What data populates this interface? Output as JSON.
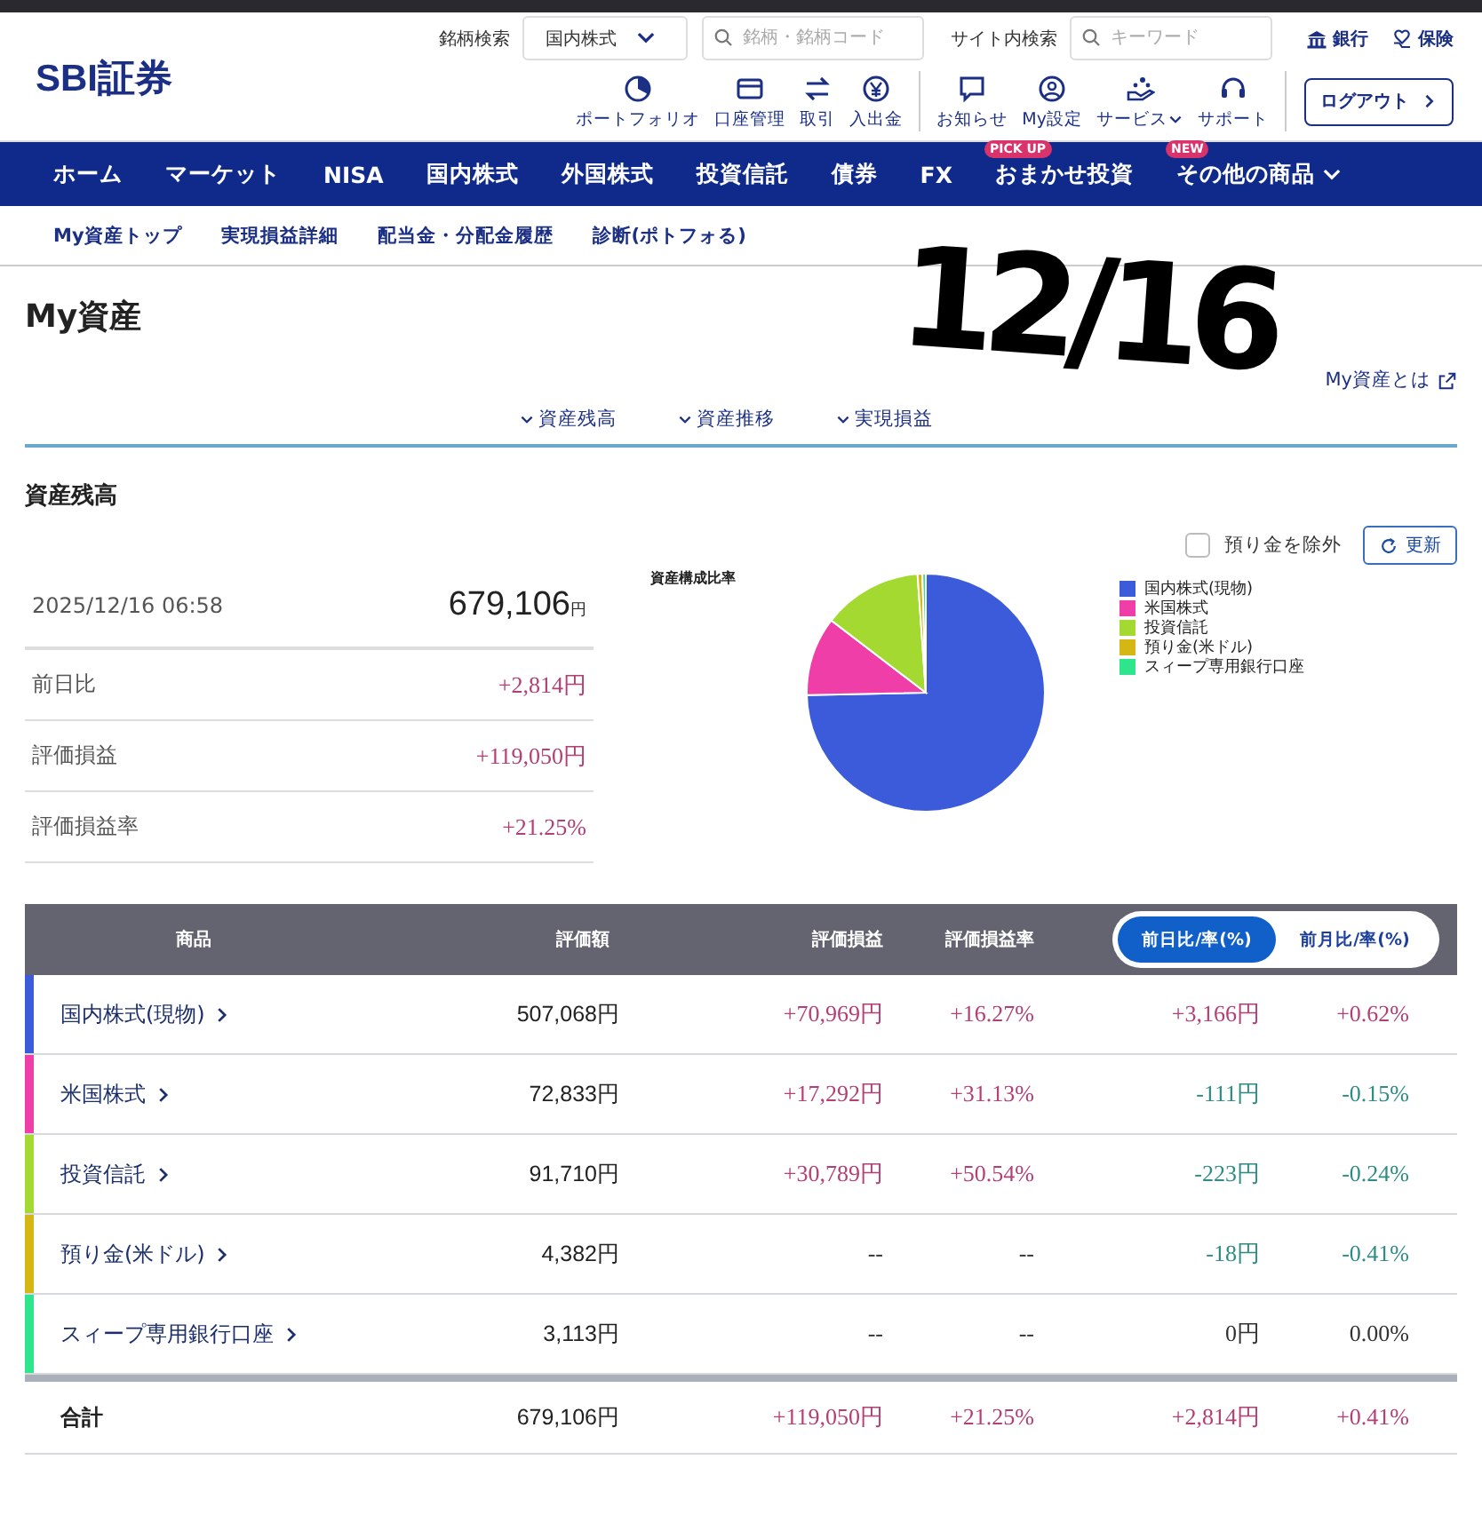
{
  "header": {
    "logo": "SBI証券",
    "stock_search": {
      "label": "銘柄検索",
      "market": "国内株式",
      "placeholder": "銘柄・銘柄コード"
    },
    "site_search": {
      "label": "サイト内検索",
      "placeholder": "キーワード"
    },
    "links": [
      {
        "label": "銀行",
        "kind": "bank"
      },
      {
        "label": "保険",
        "kind": "insurance"
      }
    ],
    "tool_groups": [
      [
        {
          "label": "ポートフォリオ",
          "kind": "portfolio",
          "dropdown": false
        },
        {
          "label": "口座管理",
          "kind": "account",
          "dropdown": false
        },
        {
          "label": "取引",
          "kind": "trade",
          "dropdown": false
        },
        {
          "label": "入出金",
          "kind": "deposit",
          "dropdown": false
        }
      ],
      [
        {
          "label": "お知らせ",
          "kind": "notice",
          "dropdown": false
        },
        {
          "label": "My設定",
          "kind": "user",
          "dropdown": false
        },
        {
          "label": "サービス",
          "kind": "service",
          "dropdown": true
        },
        {
          "label": "サポート",
          "kind": "support",
          "dropdown": false
        }
      ]
    ],
    "logout": "ログアウト"
  },
  "nav": [
    {
      "label": "ホーム",
      "dropdown": false
    },
    {
      "label": "マーケット",
      "dropdown": false
    },
    {
      "label": "NISA",
      "dropdown": false
    },
    {
      "label": "国内株式",
      "dropdown": false
    },
    {
      "label": "外国株式",
      "dropdown": false
    },
    {
      "label": "投資信託",
      "dropdown": false
    },
    {
      "label": "債券",
      "dropdown": false
    },
    {
      "label": "FX",
      "dropdown": false
    },
    {
      "label": "おまかせ投資",
      "badge": "PICK UP",
      "dropdown": false
    },
    {
      "label": "その他の商品",
      "badge": "NEW",
      "dropdown": true
    }
  ],
  "subnav": [
    "My資産トップ",
    "実現損益詳細",
    "配当金・分配金履歴",
    "診断(ポトフォる)"
  ],
  "page": {
    "title": "My資産",
    "help_link": "My資産とは",
    "anchors": [
      "資産残高",
      "資産推移",
      "実現損益"
    ]
  },
  "handwriting": "12/16",
  "balance": {
    "heading": "資産残高",
    "exclude_deposit": {
      "label": "預り金を除外",
      "checked": false
    },
    "refresh": "更新",
    "timestamp": "2025/12/16 06:58",
    "total": "679,106",
    "currency": "円",
    "rows": [
      {
        "label": "前日比",
        "value": "+2,814円",
        "kind": "gain"
      },
      {
        "label": "評価損益",
        "value": "+119,050円",
        "kind": "gain"
      },
      {
        "label": "評価損益率",
        "value": "+21.25%",
        "kind": "gain"
      }
    ]
  },
  "chart": {
    "chart_data": {
      "type": "pie",
      "title": "資産構成比率",
      "categories": [
        "国内株式(現物)",
        "米国株式",
        "投資信託",
        "預り金(米ドル)",
        "スィープ専用銀行口座"
      ],
      "values": [
        74.67,
        10.72,
        13.5,
        0.65,
        0.46
      ]
    },
    "slices": [
      {
        "color": "#3b5bdb"
      },
      {
        "color": "#f03ea8"
      },
      {
        "color": "#a3d930"
      },
      {
        "color": "#d4b614"
      },
      {
        "color": "#2ee58c"
      }
    ]
  },
  "holdings": {
    "columns": [
      "商品",
      "評価額",
      "評価損益",
      "評価損益率"
    ],
    "toggle": [
      {
        "label": "前日比/率(%)",
        "selected": true
      },
      {
        "label": "前月比/率(%)",
        "selected": false
      }
    ],
    "rows": [
      {
        "color": "#3b5bdb",
        "cells": [
          {
            "text": "国内株式(現物)",
            "kind": "link"
          },
          {
            "text": "507,068円",
            "kind": "plain"
          },
          {
            "text": "+70,969円",
            "kind": "gain"
          },
          {
            "text": "+16.27%",
            "kind": "gain"
          },
          {
            "text": "+3,166円",
            "kind": "gain"
          },
          {
            "text": "+0.62%",
            "kind": "gain"
          }
        ]
      },
      {
        "color": "#f03ea8",
        "cells": [
          {
            "text": "米国株式",
            "kind": "link"
          },
          {
            "text": "72,833円",
            "kind": "plain"
          },
          {
            "text": "+17,292円",
            "kind": "gain"
          },
          {
            "text": "+31.13%",
            "kind": "gain"
          },
          {
            "text": "-111円",
            "kind": "loss"
          },
          {
            "text": "-0.15%",
            "kind": "loss"
          }
        ]
      },
      {
        "color": "#a3d930",
        "cells": [
          {
            "text": "投資信託",
            "kind": "link"
          },
          {
            "text": "91,710円",
            "kind": "plain"
          },
          {
            "text": "+30,789円",
            "kind": "gain"
          },
          {
            "text": "+50.54%",
            "kind": "gain"
          },
          {
            "text": "-223円",
            "kind": "loss"
          },
          {
            "text": "-0.24%",
            "kind": "loss"
          }
        ]
      },
      {
        "color": "#d4b614",
        "cells": [
          {
            "text": "預り金(米ドル)",
            "kind": "link"
          },
          {
            "text": "4,382円",
            "kind": "plain"
          },
          {
            "text": "--",
            "kind": "even"
          },
          {
            "text": "--",
            "kind": "even"
          },
          {
            "text": "-18円",
            "kind": "loss"
          },
          {
            "text": "-0.41%",
            "kind": "loss"
          }
        ]
      },
      {
        "color": "#2ee58c",
        "cells": [
          {
            "text": "スィープ専用銀行口座",
            "kind": "link"
          },
          {
            "text": "3,113円",
            "kind": "plain"
          },
          {
            "text": "--",
            "kind": "even"
          },
          {
            "text": "--",
            "kind": "even"
          },
          {
            "text": "0円",
            "kind": "even"
          },
          {
            "text": "0.00%",
            "kind": "even"
          }
        ]
      }
    ],
    "total": {
      "cells": [
        {
          "text": "合計",
          "kind": "label"
        },
        {
          "text": "679,106円",
          "kind": "plain"
        },
        {
          "text": "+119,050円",
          "kind": "gain"
        },
        {
          "text": "+21.25%",
          "kind": "gain"
        },
        {
          "text": "+2,814円",
          "kind": "gain"
        },
        {
          "text": "+0.41%",
          "kind": "gain"
        }
      ]
    }
  }
}
